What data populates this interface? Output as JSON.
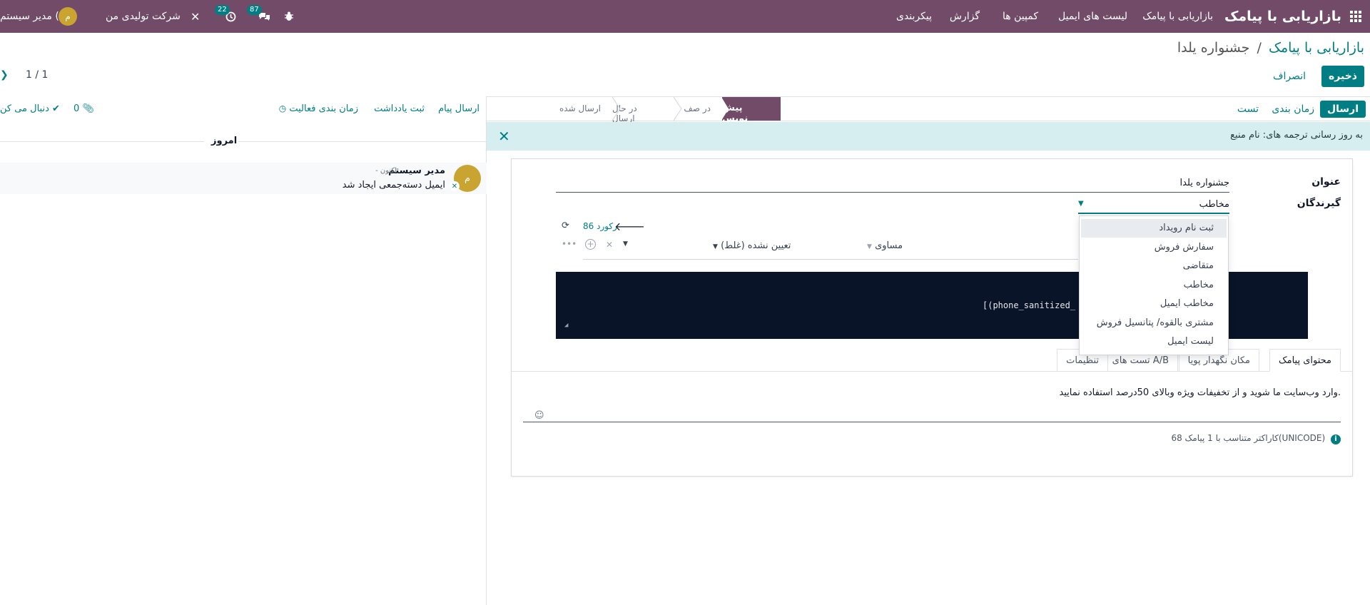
{
  "navbar": {
    "app_name": "بازاریابی با پیامک",
    "menu": [
      "بازاریابی با پیامک",
      "لیست های ایمیل",
      "کمپین ها",
      "گزارش",
      "پیکربندی"
    ],
    "user_name": "مدیر سیستم (",
    "avatar_letter": "م",
    "company": "شرکت تولیدی من",
    "badge_messages": "87",
    "badge_activities": "22"
  },
  "breadcrumb": {
    "parent": "بازاریابی با پیامک",
    "separator": "/",
    "current": "جشنواره یلدا"
  },
  "actions": {
    "save": "ذخیره",
    "discard": "انصراف"
  },
  "pager": {
    "value": "1 / 1"
  },
  "statusbar": {
    "send": "ارسال",
    "schedule": "زمان بندی",
    "test": "تست",
    "stages": [
      "پیش نویس",
      "در صف",
      "در حال ارسال",
      "ارسال شده"
    ],
    "active_stage": 0
  },
  "banner": {
    "text": "به روز رسانی ترجمه های: نام منبع"
  },
  "form": {
    "title_label": "عنوان",
    "title_value": "جشنواره یلدا",
    "recipients_label": "گیرندگان",
    "recipients_value": "مخاطب",
    "records_count": "86 رکورد",
    "domain_operator": "مساوی",
    "domain_value": "تعیین نشده (غلط)",
    "code_text": "[(phone_sanitized_"
  },
  "dropdown": {
    "options": [
      "ثبت نام رویداد",
      "سفارش فروش",
      "متقاضی",
      "مخاطب",
      "مخاطب ایمیل",
      "مشتری بالقوه/ پتانسیل فروش",
      "لیست ایمیل"
    ],
    "highlighted": 0
  },
  "tabs": [
    "محتوای پیامک",
    "مکان نگهدار پویا",
    "تست های A/B",
    "تنظیمات"
  ],
  "sms": {
    "body": "وارد وب‌سایت ما شوید و از تخفیفات ویژه وبالای 50درصد استفاده نمایید.",
    "char_info": "68 کاراکتر متناسب با 1 پیامک(UNICODE)"
  },
  "chatter": {
    "send_message": "ارسال پیام",
    "log_note": "ثبت یادداشت",
    "schedule_activity": "زمان بندی فعالیت",
    "attachments": "0",
    "following": "دنبال می کن",
    "today": "امروز",
    "message": {
      "author": "مدیر سیستم",
      "time": "- اکنون",
      "body": "ایمیل دسته‌جمعی ایجاد شد"
    }
  },
  "colors": {
    "brand": "#714B67",
    "accent": "#017E84"
  }
}
